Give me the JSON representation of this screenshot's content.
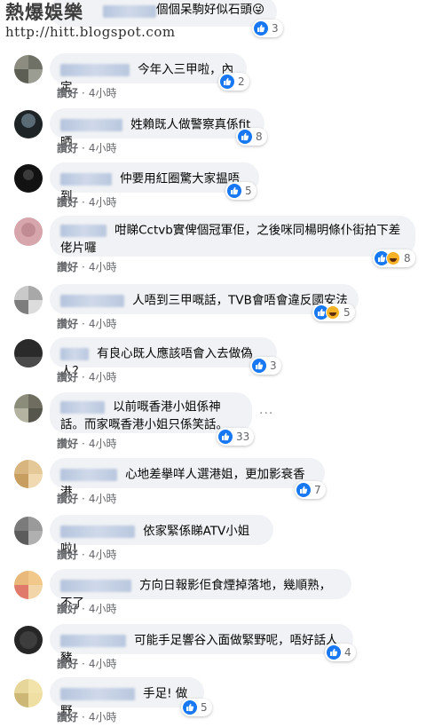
{
  "watermark": {
    "title": "熱爆娛樂",
    "url": "http://hitt.blogspot.com"
  },
  "labels": {
    "like": "讚好",
    "sep": "·"
  },
  "colors": {
    "like_blue": "#1877f2",
    "bubble_gray": "#f0f2f5",
    "meta_gray": "#65676b"
  },
  "comments": [
    {
      "text": "個個呆駒好似石頭😜",
      "reactions": [
        "like-icon"
      ],
      "count": "3",
      "time": ""
    },
    {
      "text": "今年入三甲啦，內定",
      "reactions": [
        "like-icon"
      ],
      "count": "2",
      "time": "4小時"
    },
    {
      "text": "姓賴既人做警察真係fit晒",
      "reactions": [
        "like-icon"
      ],
      "count": "8",
      "time": "4小時"
    },
    {
      "text": "仲要用紅圈驚大家揾唔到",
      "reactions": [
        "like-icon"
      ],
      "count": "5",
      "time": "4小時"
    },
    {
      "text": "咁睇Cctvb實俾個冠軍佢，之後咪同楊明條仆街拍下差佬片囉",
      "reactions": [
        "like-icon",
        "haha-icon"
      ],
      "count": "8",
      "time": "4小時"
    },
    {
      "text": "人唔到三甲嘅話，TVB會唔會違反國安法",
      "reactions": [
        "like-icon",
        "haha-icon"
      ],
      "count": "5",
      "time": "4小時"
    },
    {
      "text": "有良心既人應該唔會入去做偽人？",
      "reactions": [
        "like-icon"
      ],
      "count": "3",
      "time": "4小時"
    },
    {
      "text": "以前嘅香港小姐係神話。而家嘅香港小姐只係笑話。",
      "reactions": [
        "like-icon"
      ],
      "count": "33",
      "time": "4小時"
    },
    {
      "text": "心地差擧咩人選港姐，更加影衰香港",
      "reactions": [
        "like-icon"
      ],
      "count": "7",
      "time": "4小時"
    },
    {
      "text": "依家緊係睇ATV小姐啦!",
      "reactions": [],
      "count": "",
      "time": "4小時"
    },
    {
      "text": "方向日報影佢食煙掉落地，幾順熟，不了",
      "reactions": [],
      "count": "",
      "time": "4小時"
    },
    {
      "text": "可能手足響谷入面做緊野呢，唔好話人豬",
      "reactions": [
        "like-icon"
      ],
      "count": "4",
      "time": "4小時"
    },
    {
      "text": "手足! 做野",
      "reactions": [
        "like-icon"
      ],
      "count": "5",
      "time": "4小時"
    }
  ]
}
